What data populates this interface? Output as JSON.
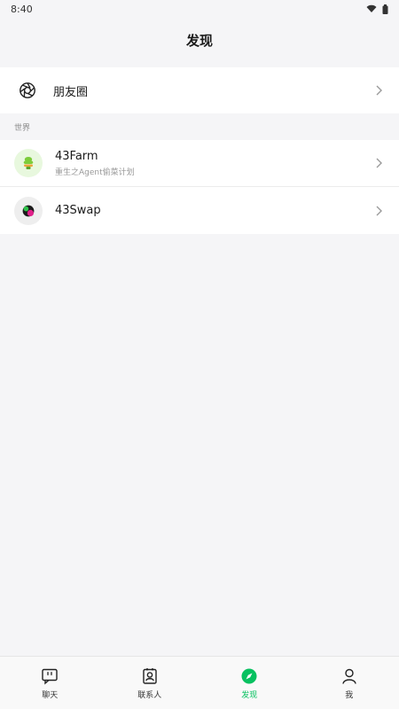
{
  "status_bar": {
    "time": "8:40",
    "icons": [
      "wifi-icon",
      "battery-icon"
    ]
  },
  "header": {
    "title": "发现"
  },
  "moments": {
    "label": "朋友圈",
    "icon": "aperture-icon"
  },
  "world_section": {
    "title": "世界",
    "items": [
      {
        "name": "43Farm",
        "subtitle": "重生之Agent偷菜计划",
        "icon": "farm-icon"
      },
      {
        "name": "43Swap",
        "subtitle": "",
        "icon": "swap-icon"
      }
    ]
  },
  "tab_bar": {
    "items": [
      {
        "label": "聊天",
        "icon": "chat-icon",
        "active": false
      },
      {
        "label": "联系人",
        "icon": "contacts-icon",
        "active": false
      },
      {
        "label": "发现",
        "icon": "compass-icon",
        "active": true
      },
      {
        "label": "我",
        "icon": "person-icon",
        "active": false
      }
    ]
  },
  "colors": {
    "accent": "#07c160",
    "background": "#f5f5f7",
    "card": "#ffffff"
  }
}
